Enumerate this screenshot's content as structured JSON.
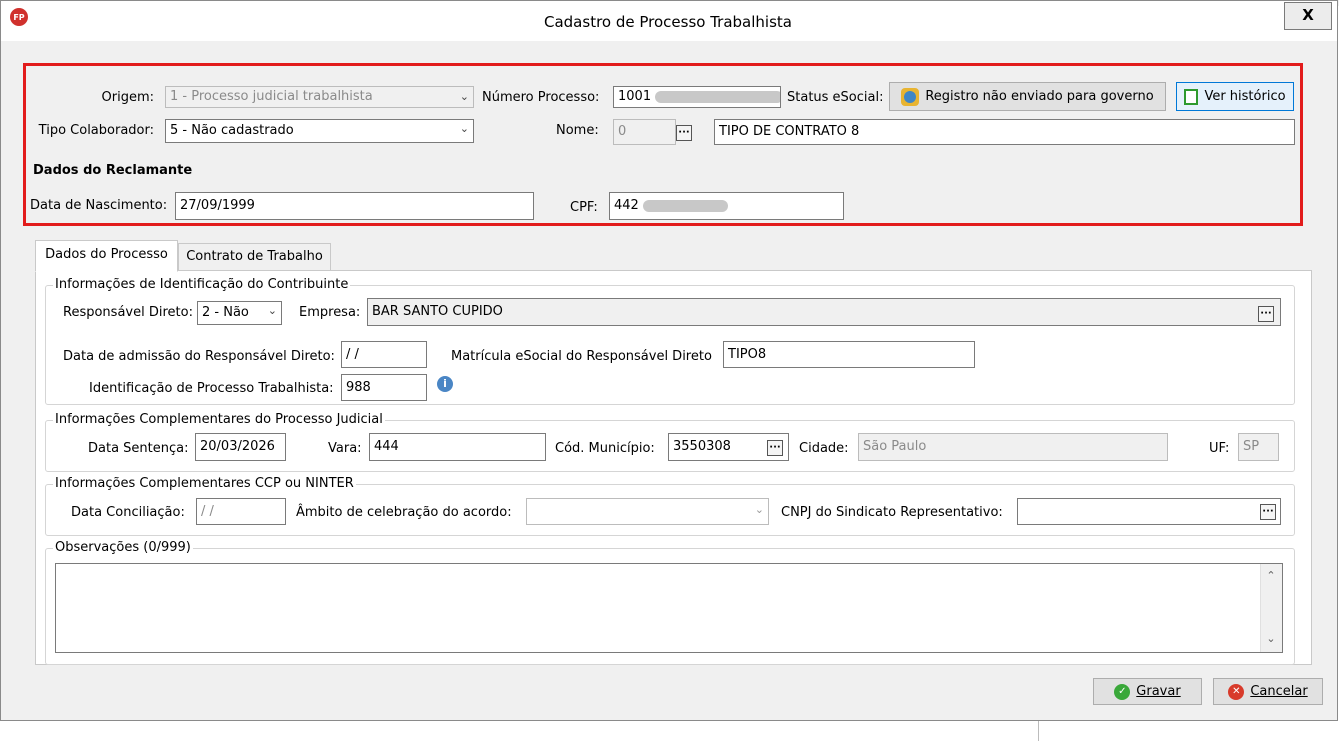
{
  "window": {
    "title": "Cadastro de Processo Trabalhista",
    "close_label": "X",
    "app_icon": "FP"
  },
  "header": {
    "origem_label": "Origem:",
    "origem_value": "1 - Processo judicial trabalhista",
    "numero_label": "Número Processo:",
    "numero_value": "1001",
    "status_label": "Status eSocial:",
    "status_button": "Registro não enviado para governo",
    "historico_button": "Ver histórico",
    "tipo_label": "Tipo Colaborador:",
    "tipo_value": "5 - Não cadastrado",
    "nome_label": "Nome:",
    "nome_code": "0",
    "nome_value": "TIPO DE CONTRATO 8",
    "reclamante_heading": "Dados do Reclamante",
    "nascimento_label": "Data de Nascimento:",
    "nascimento_value": "27/09/1999",
    "cpf_label": "CPF:",
    "cpf_value": "442"
  },
  "tabs": [
    {
      "label": "Dados do Processo",
      "active": true
    },
    {
      "label": "Contrato de Trabalho",
      "active": false
    }
  ],
  "identificacao": {
    "legend": "Informações de Identificação do Contribuinte",
    "responsavel_label": "Responsável Direto:",
    "responsavel_value": "2 - Não",
    "empresa_label": "Empresa:",
    "empresa_value": "BAR SANTO CUPIDO",
    "admissao_label": "Data de admissão do Responsável Direto:",
    "admissao_value": " / /",
    "matricula_label": "Matrícula eSocial do Responsável Direto",
    "matricula_value": "TIPO8",
    "ident_label": "Identificação de Processo Trabalhista:",
    "ident_value": "988",
    "info_icon": "i"
  },
  "judicial": {
    "legend": "Informações Complementares do Processo Judicial",
    "sentenca_label": "Data Sentença:",
    "sentenca_value": "20/03/2026",
    "vara_label": "Vara:",
    "vara_value": "444",
    "municipio_label": "Cód. Município:",
    "municipio_value": "3550308",
    "cidade_label": "Cidade:",
    "cidade_value": "São Paulo",
    "uf_label": "UF:",
    "uf_value": "SP"
  },
  "ccp": {
    "legend": "Informações Complementares CCP ou NINTER",
    "conciliacao_label": "Data Conciliação:",
    "conciliacao_value": " / /",
    "ambito_label": "Âmbito de celebração do acordo:",
    "ambito_value": "",
    "cnpj_label": "CNPJ do Sindicato Representativo:",
    "cnpj_value": ""
  },
  "observacoes": {
    "legend": "Observações (0/999)",
    "value": ""
  },
  "footer": {
    "gravar": "Gravar",
    "cancelar": "Cancelar"
  },
  "colors": {
    "highlight": "#e21b1b",
    "ok": "#3aa83a",
    "cancel": "#d83b2b"
  },
  "icons": [
    "app-logo-icon",
    "close-icon",
    "chevron-down-icon",
    "ellipsis-icon",
    "status-globe-icon",
    "history-icon",
    "info-icon",
    "scroll-up-icon",
    "scroll-down-icon",
    "check-circle-icon",
    "cancel-circle-icon"
  ]
}
